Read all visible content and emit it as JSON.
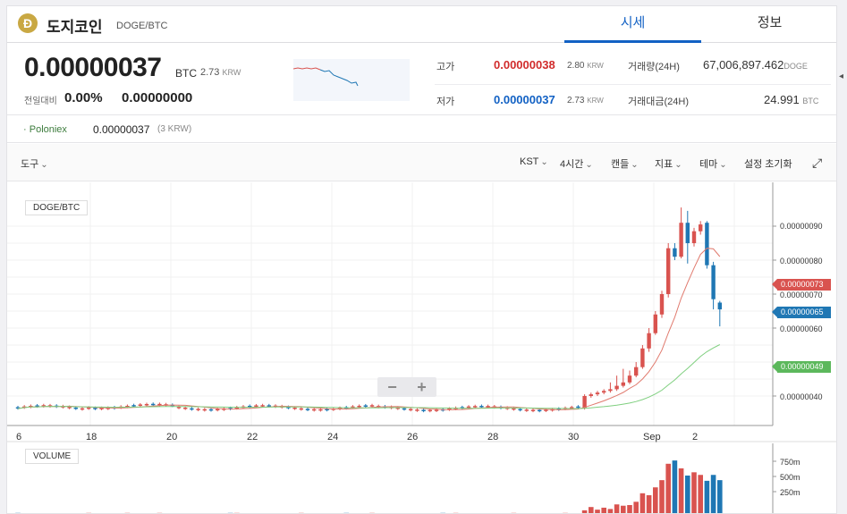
{
  "header": {
    "coin_logo": "Đ",
    "coin_name": "도지코인",
    "pair": "DOGE/BTC",
    "tabs": [
      {
        "label": "시세"
      },
      {
        "label": "정보"
      }
    ]
  },
  "price": {
    "value": "0.00000037",
    "unit": "BTC",
    "krw": "2.73",
    "krw_unit": "KRW",
    "change_label": "전일대비",
    "change_rate": "0.00%",
    "change_value": "0.00000000"
  },
  "stats": {
    "high_label": "고가",
    "high_value": "0.00000038",
    "high_krw": "2.80",
    "high_krw_unit": "KRW",
    "low_label": "저가",
    "low_value": "0.00000037",
    "low_krw": "2.73",
    "low_krw_unit": "KRW",
    "volume_label": "거래량(24H)",
    "volume_value": "67,006,897.462",
    "volume_unit": "DOGE",
    "amount_label": "거래대금(24H)",
    "amount_value": "24.991",
    "amount_unit": "BTC"
  },
  "exchange": {
    "name": "Poloniex",
    "price": "0.00000037",
    "krw": "(3 KRW)"
  },
  "toolbar": {
    "tools": "도구",
    "timezone": "KST",
    "interval": "4시간",
    "chart_type": "캔들",
    "indicator": "지표",
    "theme": "테마",
    "reset": "설정 초기화"
  },
  "chart": {
    "pair_label": "DOGE/BTC",
    "volume_label": "VOLUME",
    "zoom_out": "−",
    "zoom_in": "+",
    "tags": {
      "red": "0.00000073",
      "blue": "0.00000065",
      "green": "0.00000049"
    }
  },
  "chart_data": {
    "type": "candlestick",
    "y_ticks": [
      "0.00000040",
      "0.00000050",
      "0.00000060",
      "0.00000070",
      "0.00000080",
      "0.00000090"
    ],
    "x_ticks": [
      "6",
      "18",
      "20",
      "22",
      "24",
      "26",
      "28",
      "30",
      "Sep",
      "2"
    ],
    "volume_ticks": [
      "250m",
      "500m",
      "750m"
    ],
    "colors": {
      "up": "#d9534f",
      "down": "#1f77b4",
      "ma_fast": "#e07a6e",
      "ma_slow": "#7fcf7f"
    },
    "late_candles": [
      {
        "o": 0.365,
        "c": 0.4,
        "h": 0.405,
        "l": 0.36
      },
      {
        "o": 0.4,
        "c": 0.405,
        "h": 0.41,
        "l": 0.395
      },
      {
        "o": 0.405,
        "c": 0.41,
        "h": 0.415,
        "l": 0.4
      },
      {
        "o": 0.41,
        "c": 0.415,
        "h": 0.42,
        "l": 0.405
      },
      {
        "o": 0.415,
        "c": 0.42,
        "h": 0.44,
        "l": 0.41
      },
      {
        "o": 0.42,
        "c": 0.43,
        "h": 0.46,
        "l": 0.415
      },
      {
        "o": 0.43,
        "c": 0.44,
        "h": 0.48,
        "l": 0.425
      },
      {
        "o": 0.44,
        "c": 0.46,
        "h": 0.475,
        "l": 0.435
      },
      {
        "o": 0.46,
        "c": 0.485,
        "h": 0.5,
        "l": 0.455
      },
      {
        "o": 0.485,
        "c": 0.54,
        "h": 0.55,
        "l": 0.48
      },
      {
        "o": 0.54,
        "c": 0.585,
        "h": 0.6,
        "l": 0.53
      },
      {
        "o": 0.585,
        "c": 0.64,
        "h": 0.65,
        "l": 0.58
      },
      {
        "o": 0.64,
        "c": 0.7,
        "h": 0.71,
        "l": 0.63
      },
      {
        "o": 0.7,
        "c": 0.835,
        "h": 0.85,
        "l": 0.69
      },
      {
        "o": 0.835,
        "c": 0.81,
        "h": 0.85,
        "l": 0.8
      },
      {
        "o": 0.81,
        "c": 0.91,
        "h": 0.955,
        "l": 0.805
      },
      {
        "o": 0.91,
        "c": 0.85,
        "h": 0.945,
        "l": 0.79
      },
      {
        "o": 0.85,
        "c": 0.885,
        "h": 0.895,
        "l": 0.84
      },
      {
        "o": 0.885,
        "c": 0.905,
        "h": 0.915,
        "l": 0.875
      },
      {
        "o": 0.91,
        "c": 0.785,
        "h": 0.915,
        "l": 0.775
      },
      {
        "o": 0.785,
        "c": 0.685,
        "h": 0.795,
        "l": 0.655
      },
      {
        "o": 0.675,
        "c": 0.655,
        "h": 0.68,
        "l": 0.605
      }
    ],
    "late_volumes": [
      70,
      120,
      80,
      110,
      90,
      160,
      140,
      150,
      200,
      330,
      300,
      420,
      530,
      780,
      830,
      710,
      600,
      650,
      610,
      520,
      610,
      530
    ]
  }
}
